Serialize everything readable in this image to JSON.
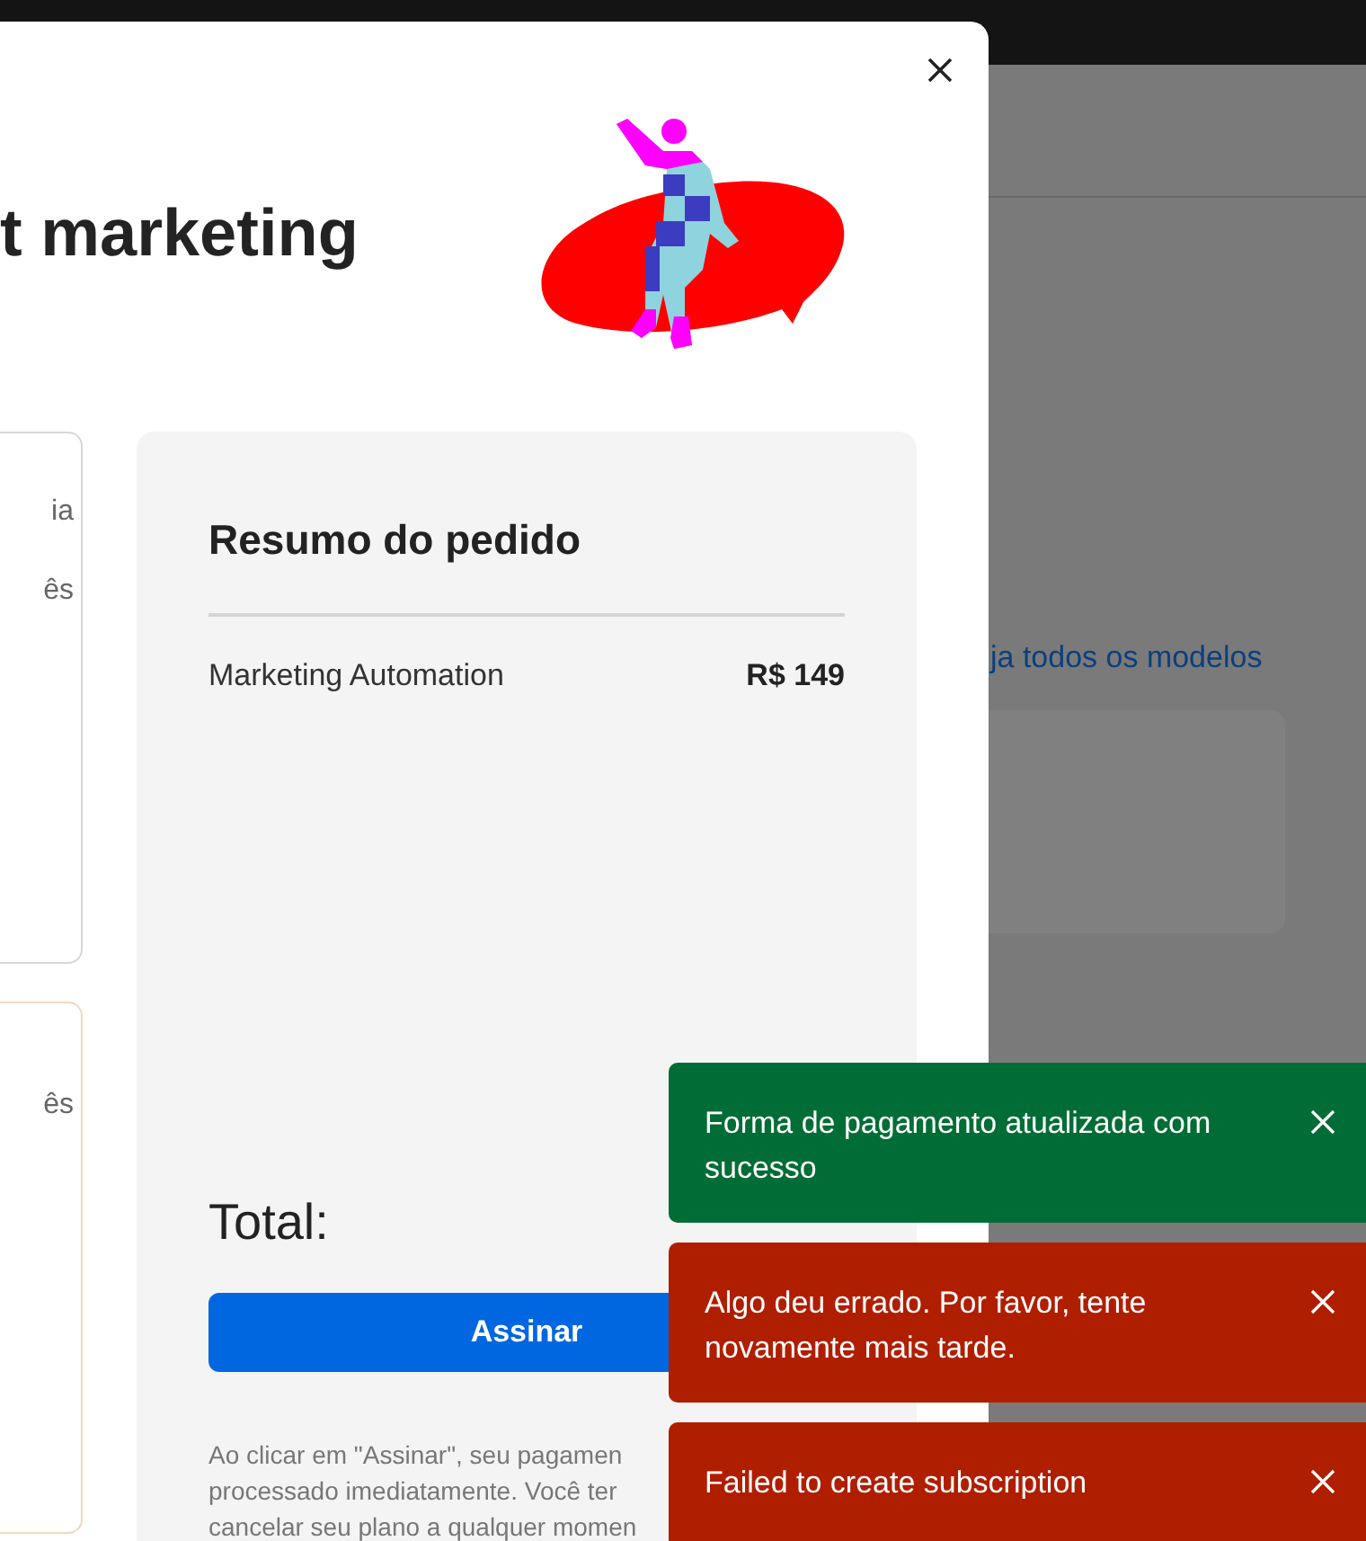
{
  "background_page": {
    "link": "ja todos os modelos"
  },
  "modal": {
    "title": "t marketing",
    "plan_cards": [
      {
        "selected": false,
        "lines": [
          "ia",
          "ês"
        ]
      },
      {
        "selected": true,
        "lines": [
          "ês"
        ]
      }
    ],
    "order_summary": {
      "title": "Resumo do pedido",
      "items": [
        {
          "name": "Marketing Automation",
          "price": "R$ 149"
        }
      ],
      "total_label": "Total:",
      "button": "Assinar",
      "fine_print": [
        "Ao clicar em \"Assinar\", seu pagamen",
        "processado imediatamente. Você ter",
        "cancelar seu plano a qualquer momen"
      ]
    }
  },
  "toasts": [
    {
      "kind": "success",
      "message": "Forma de pagamento atualizada com sucesso"
    },
    {
      "kind": "error",
      "message": "Algo deu errado. Por favor, tente novamente mais tarde."
    },
    {
      "kind": "error",
      "message": "Failed to create subscription"
    }
  ]
}
